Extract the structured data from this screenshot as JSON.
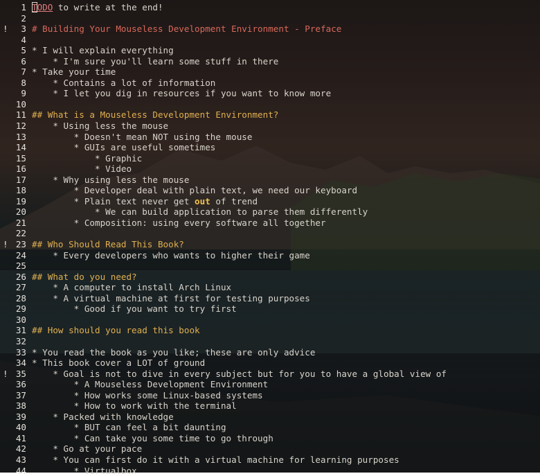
{
  "editor": {
    "lines": [
      {
        "n": "1",
        "sign": "",
        "segs": [
          {
            "t": "T",
            "c": "todo cursor"
          },
          {
            "t": "ODO",
            "c": "todo"
          },
          {
            "t": " to write at the end!",
            "c": ""
          }
        ]
      },
      {
        "n": "2",
        "sign": "",
        "segs": []
      },
      {
        "n": "3",
        "sign": "!",
        "segs": [
          {
            "t": "# Building Your Mouseless Development Environment - Preface",
            "c": "h1"
          }
        ]
      },
      {
        "n": "4",
        "sign": "",
        "segs": []
      },
      {
        "n": "5",
        "sign": "",
        "segs": [
          {
            "t": "* I will explain everything",
            "c": ""
          }
        ]
      },
      {
        "n": "6",
        "sign": "",
        "segs": [
          {
            "t": "    * I'm sure you'll learn some stuff in there",
            "c": ""
          }
        ]
      },
      {
        "n": "7",
        "sign": "",
        "segs": [
          {
            "t": "* Take your time",
            "c": ""
          }
        ]
      },
      {
        "n": "8",
        "sign": "",
        "segs": [
          {
            "t": "    * Contains a lot of information",
            "c": ""
          }
        ]
      },
      {
        "n": "9",
        "sign": "",
        "segs": [
          {
            "t": "    * I let you dig in resources if you want to know more",
            "c": ""
          }
        ]
      },
      {
        "n": "10",
        "sign": "",
        "segs": []
      },
      {
        "n": "11",
        "sign": "",
        "segs": [
          {
            "t": "## What is a Mouseless Development Environment?",
            "c": "h2"
          }
        ]
      },
      {
        "n": "12",
        "sign": "",
        "segs": [
          {
            "t": "    * Using less the mouse",
            "c": ""
          }
        ]
      },
      {
        "n": "13",
        "sign": "",
        "segs": [
          {
            "t": "        * Doesn't mean NOT using the mouse",
            "c": ""
          }
        ]
      },
      {
        "n": "14",
        "sign": "",
        "segs": [
          {
            "t": "        * GUIs are useful sometimes",
            "c": ""
          }
        ]
      },
      {
        "n": "15",
        "sign": "",
        "segs": [
          {
            "t": "            * Graphic",
            "c": ""
          }
        ]
      },
      {
        "n": "16",
        "sign": "",
        "segs": [
          {
            "t": "            * Video",
            "c": ""
          }
        ]
      },
      {
        "n": "17",
        "sign": "",
        "segs": [
          {
            "t": "    * Why using less the mouse",
            "c": ""
          }
        ]
      },
      {
        "n": "18",
        "sign": "",
        "segs": [
          {
            "t": "        * Developer deal with plain text, we need our keyboard",
            "c": ""
          }
        ]
      },
      {
        "n": "19",
        "sign": "",
        "segs": [
          {
            "t": "        * Plain text never get ",
            "c": ""
          },
          {
            "t": "out",
            "c": "bold"
          },
          {
            "t": " of trend",
            "c": ""
          }
        ]
      },
      {
        "n": "20",
        "sign": "",
        "segs": [
          {
            "t": "            * We can build application to parse them differently",
            "c": ""
          }
        ]
      },
      {
        "n": "21",
        "sign": "",
        "segs": [
          {
            "t": "        * Composition: using every software all together",
            "c": ""
          }
        ]
      },
      {
        "n": "22",
        "sign": "",
        "segs": []
      },
      {
        "n": "23",
        "sign": "!",
        "segs": [
          {
            "t": "## Who Should Read This Book?",
            "c": "h2"
          }
        ]
      },
      {
        "n": "24",
        "sign": "",
        "segs": [
          {
            "t": "    * Every developers who wants to higher their game",
            "c": ""
          }
        ]
      },
      {
        "n": "25",
        "sign": "",
        "segs": []
      },
      {
        "n": "26",
        "sign": "",
        "segs": [
          {
            "t": "## What do you need?",
            "c": "h2"
          }
        ]
      },
      {
        "n": "27",
        "sign": "",
        "segs": [
          {
            "t": "    * A computer to install Arch Linux",
            "c": ""
          }
        ]
      },
      {
        "n": "28",
        "sign": "",
        "segs": [
          {
            "t": "    * A virtual machine at first for testing purposes",
            "c": ""
          }
        ]
      },
      {
        "n": "29",
        "sign": "",
        "segs": [
          {
            "t": "        * Good if you want to try first",
            "c": ""
          }
        ]
      },
      {
        "n": "30",
        "sign": "",
        "segs": []
      },
      {
        "n": "31",
        "sign": "",
        "segs": [
          {
            "t": "## How should you read this book",
            "c": "h2"
          }
        ]
      },
      {
        "n": "32",
        "sign": "",
        "segs": []
      },
      {
        "n": "33",
        "sign": "",
        "segs": [
          {
            "t": "* You read the book as you like; these are only advice",
            "c": ""
          }
        ]
      },
      {
        "n": "34",
        "sign": "",
        "segs": [
          {
            "t": "* This book cover a LOT of ground",
            "c": ""
          }
        ]
      },
      {
        "n": "35",
        "sign": "!",
        "segs": [
          {
            "t": "    * Goal is not to dive in every subject but for you to have a global view of",
            "c": ""
          }
        ]
      },
      {
        "n": "36",
        "sign": "",
        "segs": [
          {
            "t": "        * A Mouseless Development Environment",
            "c": ""
          }
        ]
      },
      {
        "n": "37",
        "sign": "",
        "segs": [
          {
            "t": "        * How works some Linux-based systems",
            "c": ""
          }
        ]
      },
      {
        "n": "38",
        "sign": "",
        "segs": [
          {
            "t": "        * How to work with the terminal",
            "c": ""
          }
        ]
      },
      {
        "n": "39",
        "sign": "",
        "segs": [
          {
            "t": "    * Packed with knowledge",
            "c": ""
          }
        ]
      },
      {
        "n": "40",
        "sign": "",
        "segs": [
          {
            "t": "        * BUT can feel a bit daunting",
            "c": ""
          }
        ]
      },
      {
        "n": "41",
        "sign": "",
        "segs": [
          {
            "t": "        * Can take you some time to go through",
            "c": ""
          }
        ]
      },
      {
        "n": "42",
        "sign": "",
        "segs": [
          {
            "t": "    * Go at your pace",
            "c": ""
          }
        ]
      },
      {
        "n": "43",
        "sign": "",
        "segs": [
          {
            "t": "    * You can first do it with a virtual machine for learning purposes",
            "c": ""
          }
        ]
      },
      {
        "n": "44",
        "sign": "",
        "segs": [
          {
            "t": "        * Virtualbox",
            "c": ""
          }
        ]
      }
    ]
  }
}
